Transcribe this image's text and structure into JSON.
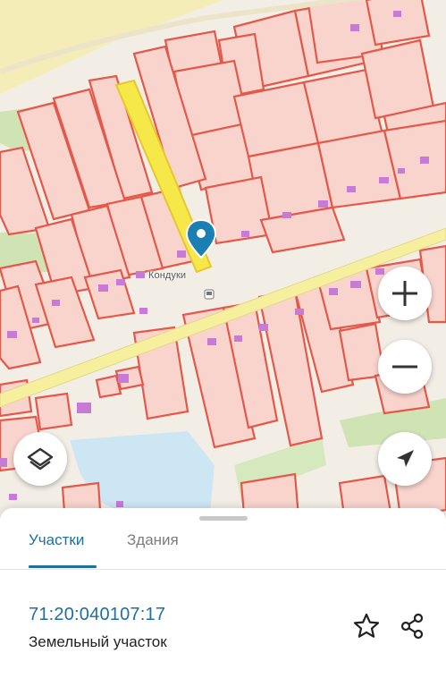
{
  "map": {
    "place_label": "Кондуки"
  },
  "controls": {
    "zoom_in_icon": "plus-icon",
    "zoom_out_icon": "minus-icon",
    "layers_icon": "layers-icon",
    "locate_icon": "navigation-arrow-icon"
  },
  "colors": {
    "parcel_stroke": "#e4584a",
    "parcel_fill": "#f8d4cd",
    "selected_parcel": "#f7e84a",
    "building": "#c77ad6",
    "water": "#cde6f4",
    "green": "#cfe3b5",
    "accent": "#1f6f9f",
    "marker": "#1c7fb3"
  },
  "sheet": {
    "tabs": [
      {
        "label": "Участки",
        "active": true
      },
      {
        "label": "Здания",
        "active": false
      }
    ],
    "result": {
      "cadastral_number": "71:20:040107:17",
      "type": "Земельный участок"
    },
    "actions": {
      "favorite_icon": "star-icon",
      "share_icon": "share-icon"
    }
  }
}
